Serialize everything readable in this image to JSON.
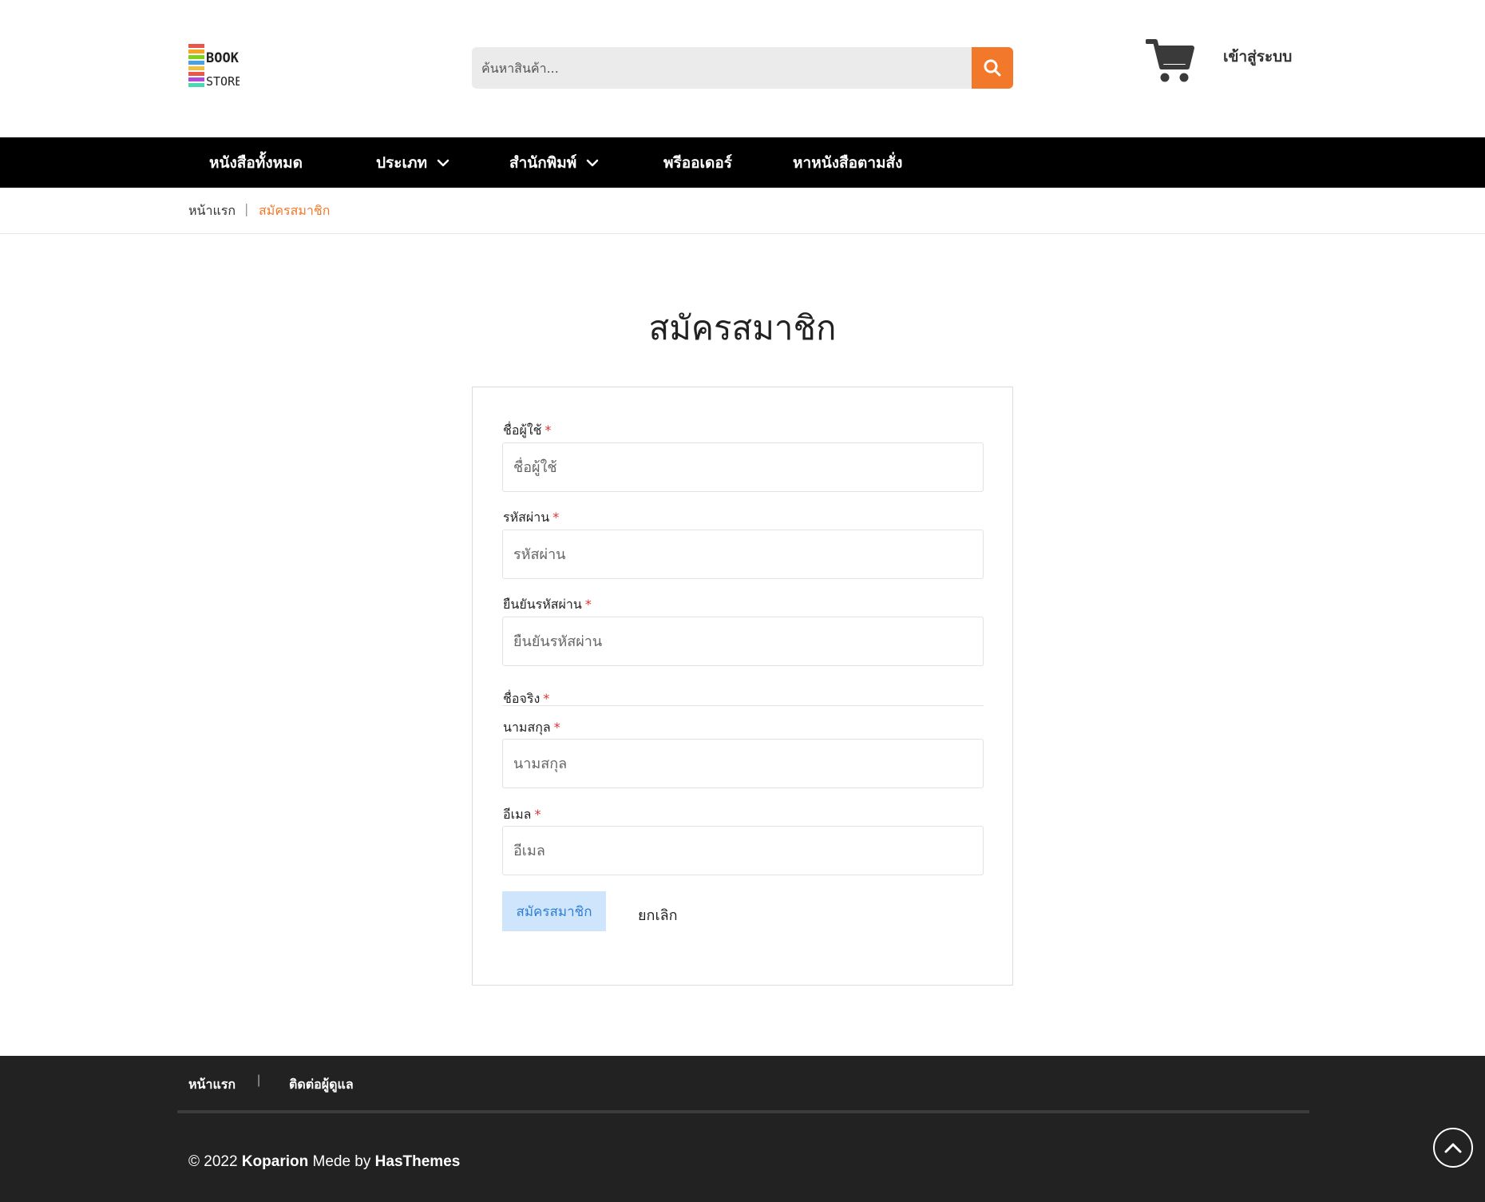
{
  "header": {
    "logo_text": "BOOK STORE",
    "search_placeholder": "ค้นหาสินค้า...",
    "login_label": "เข้าสู่ระบบ",
    "accent_color": "#f2792a"
  },
  "nav": {
    "items": [
      {
        "label": "หนังสือทั้งหมด",
        "has_dropdown": false
      },
      {
        "label": "ประเภท",
        "has_dropdown": true
      },
      {
        "label": "สำนักพิมพ์",
        "has_dropdown": true
      },
      {
        "label": "พรีออเดอร์",
        "has_dropdown": false
      },
      {
        "label": "หาหนังสือตามสั่ง",
        "has_dropdown": false
      }
    ]
  },
  "breadcrumb": {
    "home": "หน้าแรก",
    "separator": "|",
    "current": "สมัครสมาชิก"
  },
  "page": {
    "title": "สมัครสมาชิก"
  },
  "form": {
    "required_mark": "*",
    "fields": [
      {
        "label": "ชื่อผู้ใช้",
        "placeholder": "ชื่อผู้ใช้",
        "value": ""
      },
      {
        "label": "รหัสผ่าน",
        "placeholder": "รหัสผ่าน",
        "value": ""
      },
      {
        "label": "ยืนยันรหัสผ่าน",
        "placeholder": "ยืนยันรหัสผ่าน",
        "value": ""
      },
      {
        "label": "ชื่อจริง",
        "placeholder": "",
        "value": ""
      },
      {
        "label": "นามสกุล",
        "placeholder": "นามสกุล",
        "value": ""
      },
      {
        "label": "อีเมล",
        "placeholder": "อีเมล",
        "value": ""
      }
    ],
    "submit_label": "สมัครสมาชิก",
    "cancel_label": "ยกเลิก"
  },
  "footer": {
    "links": [
      "หน้าแรก",
      "ติดต่อผู้ดูแล"
    ],
    "separator": "|",
    "copyright_prefix": "© 2022",
    "brand": "Koparion",
    "made_by": "Mede by",
    "author": "HasThemes"
  }
}
